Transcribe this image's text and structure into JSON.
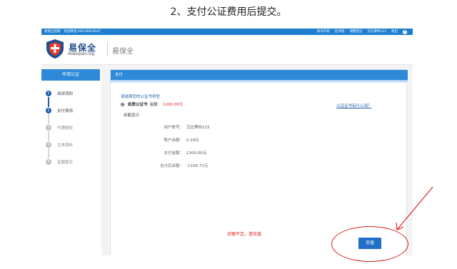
{
  "caption": "2、支付公证费用后提交。",
  "topbar": {
    "site_name": "易保全官网",
    "hotline": "欢迎致电 400-808-9187",
    "links": [
      "知识产权",
      "区块链",
      "调整登记"
    ],
    "user": "艾比蒂你123",
    "logout": "退出",
    "help_icon": "?"
  },
  "header": {
    "logo_name": "易保全",
    "logo_domain": "ebaoquan.org",
    "brand_text": "易保全"
  },
  "sidebar": {
    "title": "申请公证",
    "steps": [
      {
        "num": "1",
        "label": "阅读须知",
        "state": "done"
      },
      {
        "num": "2",
        "label": "支付费用",
        "state": "active"
      },
      {
        "num": "3",
        "label": "代理授权",
        "state": "pending"
      },
      {
        "num": "4",
        "label": "主体资料",
        "state": "pending"
      },
      {
        "num": "5",
        "label": "证据提交",
        "state": "pending"
      }
    ]
  },
  "panel": {
    "title": "支付",
    "choose_label": "请选择您的公证书类型",
    "cert_name": "纸质公证书",
    "cert_amount_label": "金额：",
    "cert_amount": "1200.00元",
    "cert_help": "公证证书有什么用？",
    "balance_title": "余额显示",
    "rows": [
      {
        "label": "用户账号：",
        "value": "艾比蒂你123"
      },
      {
        "label": "账户余额：",
        "value": "0.29元"
      },
      {
        "label": "支付金额：",
        "value": "1200.00元"
      },
      {
        "label": "支付后余额：",
        "value": "-1199.71元"
      }
    ],
    "warning": "余额不足，请充值",
    "recharge_button": "充值"
  },
  "colors": {
    "brand_blue": "#1e7fd0",
    "warning_red": "#e02020",
    "annotation_red": "#d72020"
  }
}
